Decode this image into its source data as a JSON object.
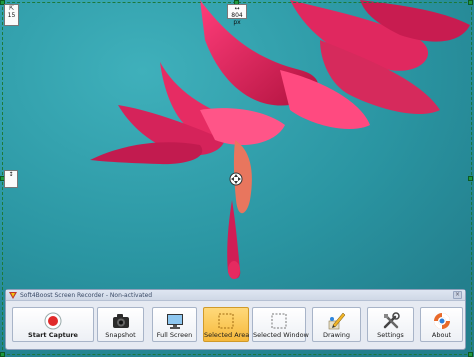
{
  "overlay": {
    "width_label": "804 px",
    "corner_label": "15",
    "height_label": ""
  },
  "recorder": {
    "title": "Soft4Boost Screen Recorder - Non-activated",
    "close": "×",
    "buttons": [
      {
        "label": "Start Capture",
        "icon": "record-icon"
      },
      {
        "label": "Snapshot",
        "icon": "camera-icon"
      },
      {
        "label": "Full Screen",
        "icon": "monitor-icon"
      },
      {
        "label": "Selected Area",
        "icon": "selected-area-icon"
      },
      {
        "label": "Selected Window",
        "icon": "window-icon"
      },
      {
        "label": "Drawing",
        "icon": "drawing-icon"
      },
      {
        "label": "Settings",
        "icon": "tools-icon"
      },
      {
        "label": "About",
        "icon": "lifebuoy-icon"
      }
    ]
  },
  "colors": {
    "background": "#2f9aa6",
    "flower": "#d8245a",
    "active_button": "#f6b93c",
    "selection_border": "#1d7a3a"
  }
}
